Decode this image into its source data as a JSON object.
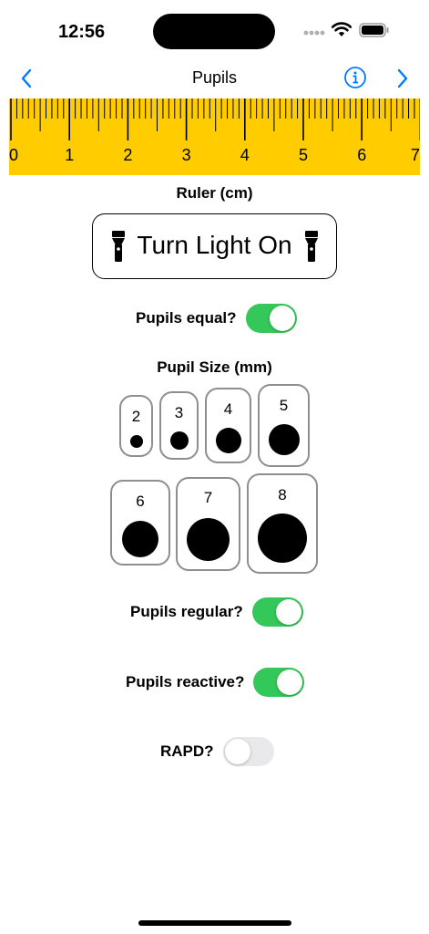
{
  "status_bar": {
    "time": "12:56"
  },
  "nav": {
    "title": "Pupils"
  },
  "ruler": {
    "unit_label": "Ruler (cm)",
    "labels": [
      "0",
      "1",
      "2",
      "3",
      "4",
      "5",
      "6",
      "7"
    ],
    "color": "#ffcc00"
  },
  "light_button": {
    "label": "Turn Light On"
  },
  "toggles": {
    "equal": {
      "label": "Pupils equal?",
      "on": true
    },
    "regular": {
      "label": "Pupils regular?",
      "on": true
    },
    "reactive": {
      "label": "Pupils reactive?",
      "on": true
    },
    "rapd": {
      "label": "RAPD?",
      "on": false
    }
  },
  "pupil_size": {
    "title": "Pupil Size (mm)",
    "sizes": [
      "2",
      "3",
      "4",
      "5",
      "6",
      "7",
      "8"
    ]
  },
  "colors": {
    "accent": "#007aff",
    "switch_on": "#34c759",
    "switch_off": "#e9e9eb"
  }
}
